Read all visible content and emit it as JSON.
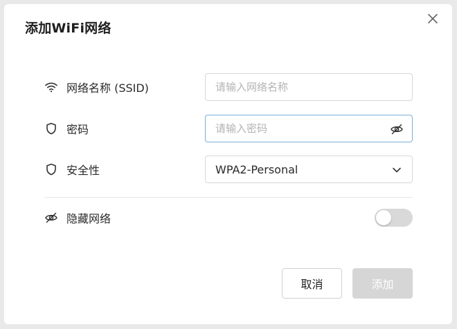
{
  "dialog": {
    "title": "添加WiFi网络",
    "close_icon": "close-icon"
  },
  "form": {
    "ssid": {
      "label": "网络名称 (SSID)",
      "placeholder": "请输入网络名称",
      "value": "",
      "icon": "wifi-icon"
    },
    "password": {
      "label": "密码",
      "placeholder": "请输入密码",
      "value": "",
      "icon": "shield-icon",
      "visibility_icon": "eye-off-icon"
    },
    "security": {
      "label": "安全性",
      "selected": "WPA2-Personal",
      "icon": "shield-icon"
    },
    "hidden_network": {
      "label": "隐藏网络",
      "icon": "eye-off-icon",
      "enabled": false
    }
  },
  "buttons": {
    "cancel_label": "取消",
    "add_label": "添加",
    "add_enabled": false
  },
  "colors": {
    "focus_border": "#7aaed6",
    "disabled_button": "#d6d6d6",
    "toggle_off": "#d9d9d9"
  }
}
